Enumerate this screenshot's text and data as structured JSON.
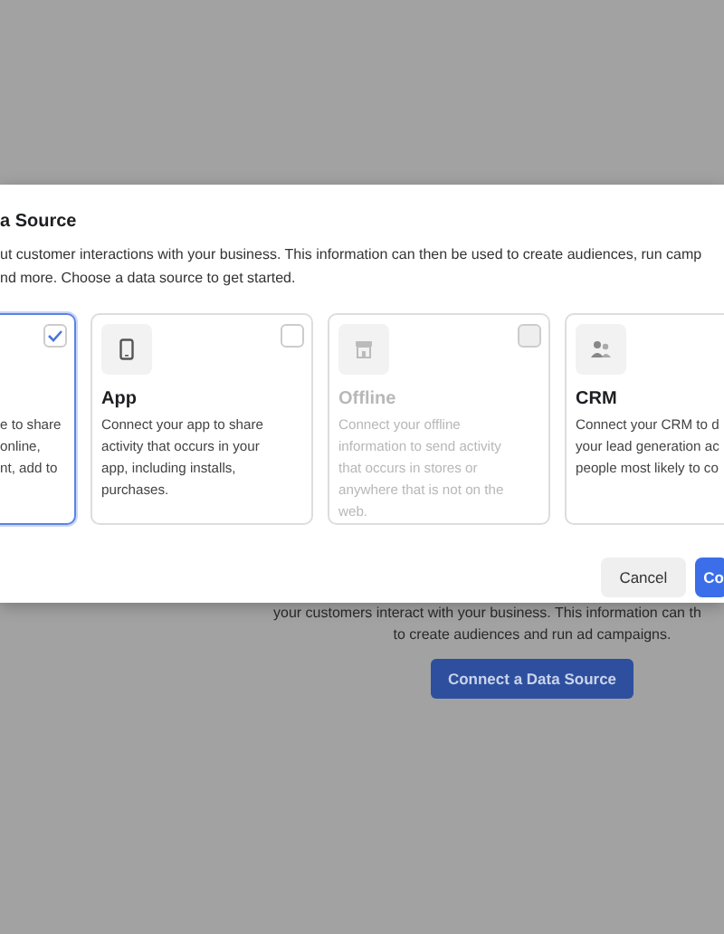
{
  "background": {
    "description_lines": [
      "your customers interact with your business. This information can th",
      "to create audiences and run ad campaigns."
    ],
    "button": "Connect a Data Source"
  },
  "dialog": {
    "title": "a Source",
    "description_lines": [
      "ut customer interactions with your business. This information can then be used to create audiences, run camp",
      "nd more. Choose a data source to get started."
    ],
    "cards": [
      {
        "kind": "cut",
        "description_lines": [
          "e to share",
          "online,",
          "nt, add to"
        ],
        "selected": true,
        "disabled": false
      },
      {
        "kind": "app",
        "title": "App",
        "description_lines": [
          "Connect your app to share",
          "activity that occurs in your",
          "app, including installs,",
          "purchases."
        ],
        "selected": false,
        "disabled": false
      },
      {
        "kind": "offline",
        "title": "Offline",
        "description_lines": [
          "Connect your offline",
          "information to send activity",
          "that occurs in stores or",
          "anywhere that is not on the",
          "web."
        ],
        "selected": false,
        "disabled": true
      },
      {
        "kind": "crm",
        "title": "CRM",
        "description_lines": [
          "Connect your CRM to d",
          "your lead generation ac",
          "people most likely to co"
        ],
        "disabled": false
      }
    ],
    "buttons": [
      {
        "label": "Cancel",
        "kind": "secondary"
      },
      {
        "label": "Co",
        "kind": "primary"
      }
    ]
  }
}
